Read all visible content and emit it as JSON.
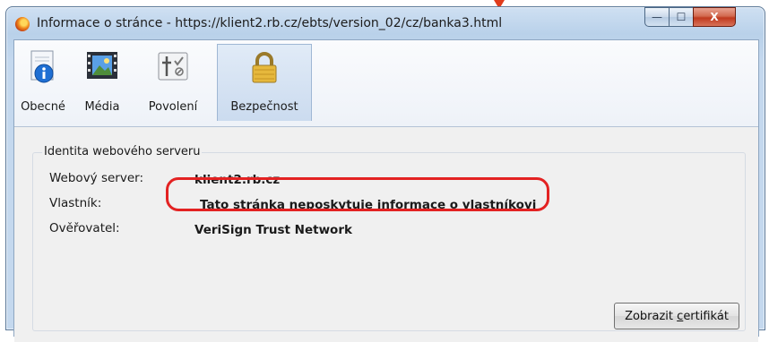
{
  "window": {
    "title": "Informace o stránce - https://klient2.rb.cz/ebts/version_02/cz/banka3.html",
    "controls": {
      "minimize": "—",
      "maximize": "☐",
      "close": "X"
    }
  },
  "tabs": [
    {
      "label": "Obecné",
      "icon": "info-icon",
      "active": false
    },
    {
      "label": "Média",
      "icon": "media-icon",
      "active": false
    },
    {
      "label": "Povolení",
      "icon": "permissions-icon",
      "active": false
    },
    {
      "label": "Bezpečnost",
      "icon": "lock-icon",
      "active": true
    }
  ],
  "identity": {
    "group_title": "Identita webového serveru",
    "rows": [
      {
        "label": "Webový server:",
        "value": "klient2.rb.cz"
      },
      {
        "label": "Vlastník:",
        "value": "Tato stránka neposkytuje informace o vlastníkovi"
      },
      {
        "label": "Ověřovatel:",
        "value": "VeriSign Trust Network"
      }
    ]
  },
  "buttons": {
    "view_certificate_pre": "Zobrazit ",
    "view_certificate_accel": "c",
    "view_certificate_post": "ertifikát"
  },
  "colors": {
    "highlight": "#e32222",
    "active_tab": "#cbdbef"
  }
}
